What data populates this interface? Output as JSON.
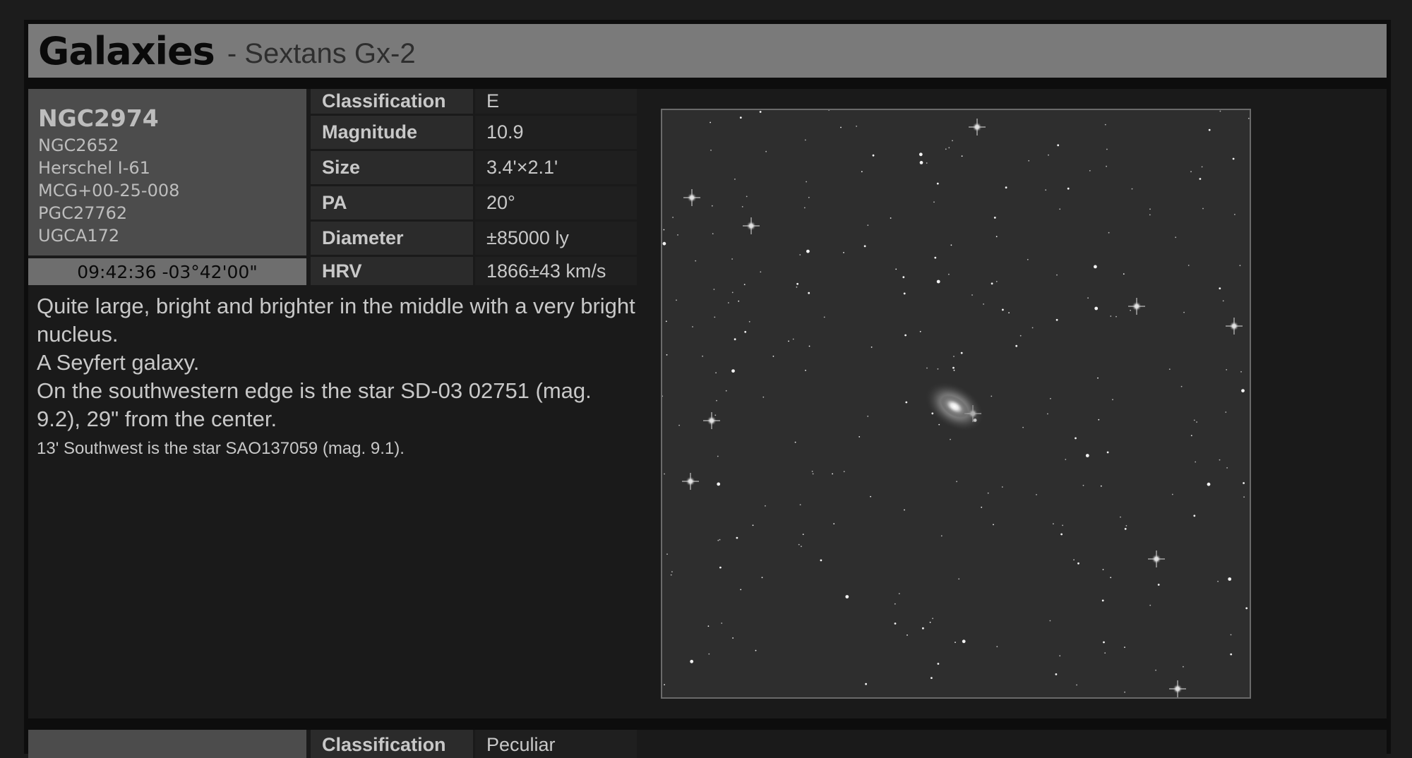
{
  "header": {
    "title": "Galaxies",
    "subtitle": "- Sextans Gx-2"
  },
  "object": {
    "primary_name": "NGC2974",
    "aliases": [
      "NGC2652",
      "Herschel I-61",
      "MCG+00-25-008",
      "PGC27762",
      "UGCA172"
    ],
    "coordinates": "09:42:36 -03°42'00\"",
    "properties": [
      {
        "key": "Classification",
        "value": "E"
      },
      {
        "key": "Magnitude",
        "value": "10.9"
      },
      {
        "key": "Size",
        "value": "3.4'×2.1'"
      },
      {
        "key": "PA",
        "value": "20°"
      },
      {
        "key": "Diameter",
        "value": "±85000 ly"
      },
      {
        "key": "HRV",
        "value": "1866±43 km/s"
      }
    ],
    "description": [
      "Quite large, bright and brighter in the middle with a very bright nucleus.",
      "A Seyfert galaxy.",
      "On the southwestern edge is the star SD-03 02751 (mag. 9.2), 29\" from the center."
    ],
    "note": "13' Southwest is the star SAO137059 (mag. 9.1).",
    "image": {
      "icon": "galaxy-photo"
    }
  },
  "next_object": {
    "classification_key": "Classification",
    "classification_value": "Peculiar"
  }
}
